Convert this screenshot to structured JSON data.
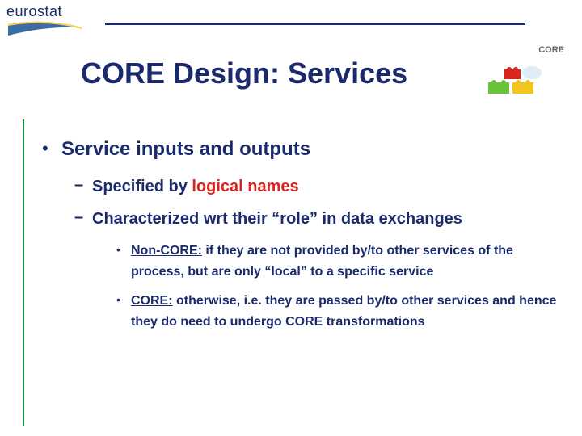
{
  "header": {
    "logo_text": "eurostat",
    "core_label": "CORE"
  },
  "title": "CORE Design: Services",
  "content": {
    "lvl1": {
      "bullet": "•",
      "text": "Service inputs and outputs"
    },
    "lvl2a": {
      "dash": "–",
      "prefix": "Specified by ",
      "red": "logical names"
    },
    "lvl2b": {
      "dash": "–",
      "text": "Characterized wrt their “role” in data exchanges"
    },
    "lvl3a": {
      "bullet": "•",
      "label": "Non-CORE:",
      "rest": " if they are not provided by/to other services of the process, but are only “local” to a specific service"
    },
    "lvl3b": {
      "bullet": "•",
      "label": "CORE:",
      "rest": " otherwise, i.e. they are passed by/to other services and hence they do need to undergo CORE transformations"
    }
  }
}
